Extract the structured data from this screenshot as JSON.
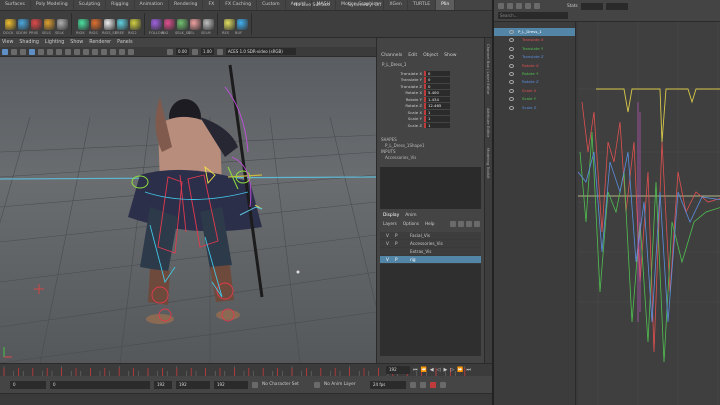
{
  "menubar": {
    "tabs": [
      "Surfaces",
      "Poly Modeling",
      "Sculpting",
      "Rigging",
      "Animation",
      "Rendering",
      "FX",
      "FX Caching",
      "Custom",
      "Arnold",
      "MASH",
      "Motion Graphics",
      "XGen",
      "TURTLE",
      "Plin"
    ],
    "active_tab": "Plin",
    "status": [
      "No Live Surface",
      "Symmetry: Off"
    ]
  },
  "shelf": {
    "labels": [
      "DOCK",
      "SDOM",
      "PRIIS",
      "SELS",
      "SELK",
      "RIGK",
      "RIGS",
      "RIGS_SS",
      "FREE",
      "RIG2",
      "FOLLOW",
      "RIG",
      "SELK_SS",
      "SEL",
      "SELM",
      "RES",
      "BUF"
    ]
  },
  "viewport_menu": [
    "View",
    "Shading",
    "Lighting",
    "Show",
    "Renderer",
    "Panels"
  ],
  "viewport_toolbar": {
    "field1": "0.00",
    "field2": "1.00",
    "colorspace": "ACES 1.0 SDR-video (sRGB)"
  },
  "channel_box": {
    "tabs": [
      "Channels",
      "Edit",
      "Object",
      "Show"
    ],
    "object_name": "P_L_Dress_1",
    "attributes": [
      {
        "name": "Translate X",
        "value": "0"
      },
      {
        "name": "Translate Y",
        "value": "0"
      },
      {
        "name": "Translate Z",
        "value": "0"
      },
      {
        "name": "Rotate X",
        "value": "5.400"
      },
      {
        "name": "Rotate Y",
        "value": "1.434"
      },
      {
        "name": "Rotate Z",
        "value": "12.465"
      },
      {
        "name": "Scale X",
        "value": "1"
      },
      {
        "name": "Scale Y",
        "value": "1"
      },
      {
        "name": "Scale Z",
        "value": "1"
      }
    ],
    "shapes_header": "SHAPES",
    "shape_name": "P_L_Dress_1Shape1",
    "inputs_header": "INPUTS",
    "input_name": "Accessories_Vis"
  },
  "layer_editor": {
    "tabs": [
      "Display",
      "Anim"
    ],
    "menu": [
      "Layers",
      "Options",
      "Help"
    ],
    "layers": [
      {
        "v": "V",
        "p": "P",
        "name": "Facial_Vis",
        "selected": false
      },
      {
        "v": "V",
        "p": "P",
        "name": "Accessories_Vis",
        "selected": false
      },
      {
        "v": "",
        "p": "",
        "name": "Extras_Vis",
        "selected": false
      },
      {
        "v": "V",
        "p": "P",
        "name": "rig",
        "selected": true
      }
    ]
  },
  "side_tabs": [
    "Channel Box / Layer Editor",
    "Attribute Editor",
    "Modeling Toolkit"
  ],
  "range": {
    "start_field": "0",
    "inner_start": "0",
    "inner_end": "192",
    "end_field": "192",
    "outer_end": "192",
    "character_set": "No Character Set",
    "anim_layer": "No Anim Layer",
    "fps": "24 fps",
    "current_frame": "192"
  },
  "graph_editor": {
    "top_label": "Stats",
    "search_placeholder": "Search...",
    "outliner": [
      {
        "label": "P_L_Dress_1",
        "selected": true,
        "color": "#ffffff"
      },
      {
        "label": "Translate X",
        "color": "#e05050"
      },
      {
        "label": "Translate Y",
        "color": "#50c050"
      },
      {
        "label": "Translate Z",
        "color": "#5a8fe0"
      },
      {
        "label": "Rotate X",
        "color": "#e05050"
      },
      {
        "label": "Rotate Y",
        "color": "#50c050"
      },
      {
        "label": "Rotate Z",
        "color": "#5a8fe0"
      },
      {
        "label": "Scale X",
        "color": "#e05050"
      },
      {
        "label": "Scale Y",
        "color": "#50c050"
      },
      {
        "label": "Scale Z",
        "color": "#5a8fe0"
      }
    ]
  },
  "colors": {
    "selection": "#5285a6",
    "keyed": "#c23b3b",
    "timeline_bg": "#3b3b3b"
  }
}
